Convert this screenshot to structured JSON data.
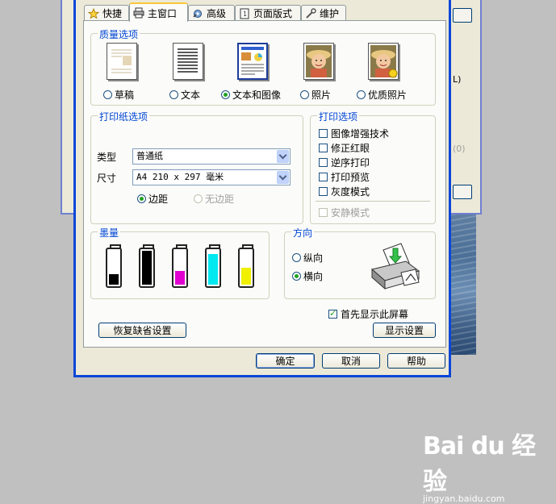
{
  "background_window": {
    "fragments": [
      "L)",
      "(0)"
    ]
  },
  "tabs": [
    {
      "label": "快捷",
      "icon": "star-icon"
    },
    {
      "label": "主窗口",
      "icon": "printer-icon",
      "active": true
    },
    {
      "label": "高级",
      "icon": "gear-icon"
    },
    {
      "label": "页面版式",
      "icon": "page-layout-icon"
    },
    {
      "label": "维护",
      "icon": "wrench-icon"
    }
  ],
  "quality": {
    "title": "质量选项",
    "options": [
      {
        "label": "草稿",
        "selected": false
      },
      {
        "label": "文本",
        "selected": false
      },
      {
        "label": "文本和图像",
        "selected": true
      },
      {
        "label": "照片",
        "selected": false
      },
      {
        "label": "优质照片",
        "selected": false
      }
    ]
  },
  "paper": {
    "title": "打印纸选项",
    "type_label": "类型",
    "type_value": "普通纸",
    "size_label": "尺寸",
    "size_value": "A4 210 x 297 毫米",
    "margin_label": "边距",
    "borderless_label": "无边距"
  },
  "print_options": {
    "title": "打印选项",
    "items": [
      {
        "label": "图像增强技术",
        "checked": false
      },
      {
        "label": "修正红眼",
        "checked": false
      },
      {
        "label": "逆序打印",
        "checked": false
      },
      {
        "label": "打印预览",
        "checked": false
      },
      {
        "label": "灰度模式",
        "checked": false
      }
    ],
    "quiet_mode": "安静模式"
  },
  "ink": {
    "title": "墨量",
    "levels": [
      {
        "color": "#000000",
        "level": 0.3
      },
      {
        "color": "#000000",
        "level": 1.0
      },
      {
        "color": "#e000d0",
        "level": 0.4
      },
      {
        "color": "#00e8f0",
        "level": 0.9
      },
      {
        "color": "#f0f000",
        "level": 0.5
      }
    ]
  },
  "orientation": {
    "title": "方向",
    "portrait": "纵向",
    "landscape": "横向",
    "selected": "landscape"
  },
  "show_screen_first": "首先显示此屏幕",
  "buttons": {
    "restore_defaults": "恢复缺省设置",
    "show_settings": "显示设置",
    "ok": "确定",
    "cancel": "取消",
    "help": "帮助"
  },
  "watermark": {
    "brand": "Bai du 经验",
    "sub": "jingyan.baidu.com"
  },
  "colors": {
    "dialog_border": "#0a46d8",
    "group_title": "#0046d5",
    "radio_on": "#21a121",
    "tab_highlight": "#ffc83c"
  }
}
